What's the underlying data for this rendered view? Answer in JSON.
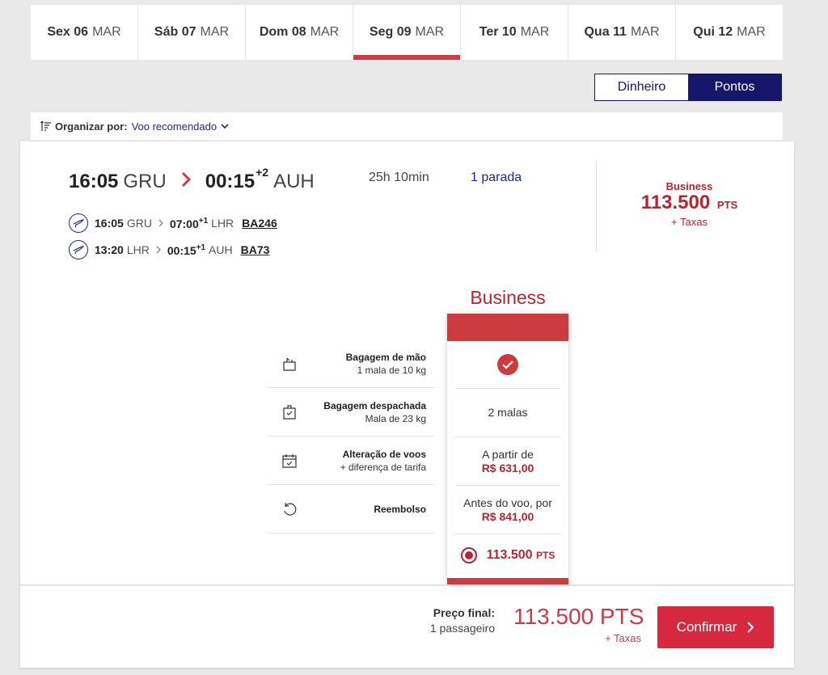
{
  "dates": [
    {
      "day": "Sex 06",
      "month": "MAR",
      "active": false
    },
    {
      "day": "Sáb 07",
      "month": "MAR",
      "active": false
    },
    {
      "day": "Dom 08",
      "month": "MAR",
      "active": false
    },
    {
      "day": "Seg 09",
      "month": "MAR",
      "active": true
    },
    {
      "day": "Ter 10",
      "month": "MAR",
      "active": false
    },
    {
      "day": "Qua 11",
      "month": "MAR",
      "active": false
    },
    {
      "day": "Qui 12",
      "month": "MAR",
      "active": false
    }
  ],
  "currency_toggle": {
    "money": "Dinheiro",
    "points": "Pontos",
    "selected": "points"
  },
  "sort": {
    "label": "Organizar por:",
    "value": "Voo recomendado"
  },
  "flight": {
    "depart_time": "16:05",
    "depart_airport": "GRU",
    "arrive_time": "00:15",
    "arrive_offset": "+2",
    "arrive_airport": "AUH",
    "duration": "25h 10min",
    "stops": "1 parada",
    "segments": [
      {
        "dep_time": "16:05",
        "dep_airport": "GRU",
        "arr_time": "07:00",
        "arr_offset": "+1",
        "arr_airport": "LHR",
        "flight_no": "BA246"
      },
      {
        "dep_time": "13:20",
        "dep_airport": "LHR",
        "arr_time": "00:15",
        "arr_offset": "+1",
        "arr_airport": "AUH",
        "flight_no": "BA73"
      }
    ],
    "fare_summary": {
      "cabin": "Business",
      "points": "113.500",
      "unit": "PTS",
      "taxes": "+ Taxas"
    }
  },
  "fare_table": {
    "title": "Business",
    "features": [
      {
        "name": "Bagagem de mão",
        "detail": "1 mala de 10 kg",
        "icon": "carry-on-bag-icon"
      },
      {
        "name": "Bagagem despachada",
        "detail": "Mala de 23 kg",
        "icon": "checked-bag-icon"
      },
      {
        "name": "Alteração de voos",
        "detail": "+ diferença de tarifa",
        "icon": "calendar-check-icon"
      },
      {
        "name": "Reembolso",
        "detail": "",
        "icon": "refund-icon"
      }
    ],
    "values": {
      "carry_on": "check-icon",
      "checked": "2 malas",
      "change_prefix": "A partir de",
      "change_price": "R$ 631,00",
      "refund_prefix": "Antes do voo, por",
      "refund_price": "R$ 841,00",
      "points": "113.500",
      "points_unit": "PTS"
    }
  },
  "footer": {
    "final_label": "Preço final:",
    "passengers": "1 passageiro",
    "price": "113.500 PTS",
    "taxes": "+ Taxas",
    "confirm": "Confirmar"
  },
  "colors": {
    "brand_red": "#d6283f",
    "navy": "#16176b",
    "accent_red": "#b8242f"
  }
}
